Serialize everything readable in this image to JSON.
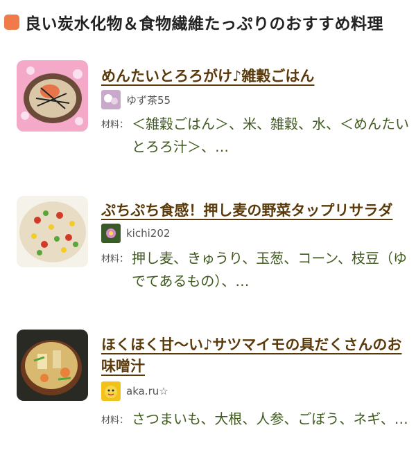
{
  "section": {
    "title": "良い炭水化物＆食物繊維たっぷりのおすすめ料理"
  },
  "recipes": [
    {
      "title": "めんたいとろろがけ♪雑穀ごはん",
      "author": "ゆず茶55",
      "ingredients_label": "材料：",
      "ingredients": "＜雑穀ごはん＞、米、雑穀、水、＜めんたいとろろ汁＞、…"
    },
    {
      "title": "ぷちぷち食感！押し麦の野菜タップリサラダ",
      "author": "kichi202",
      "ingredients_label": "材料：",
      "ingredients": "押し麦、きゅうり、玉葱、コーン、枝豆（ゆでてあるもの）、…"
    },
    {
      "title": "ほくほく甘〜い♪サツマイモの具だくさんのお味噌汁",
      "author": "aka.ru☆",
      "ingredients_label": "材料：",
      "ingredients": "さつまいも、大根、人参、ごぼう、ネギ、…"
    }
  ],
  "colors": {
    "accent": "#f07a4a",
    "title": "#5a3a0a",
    "ingredients": "#3f5a1e"
  }
}
